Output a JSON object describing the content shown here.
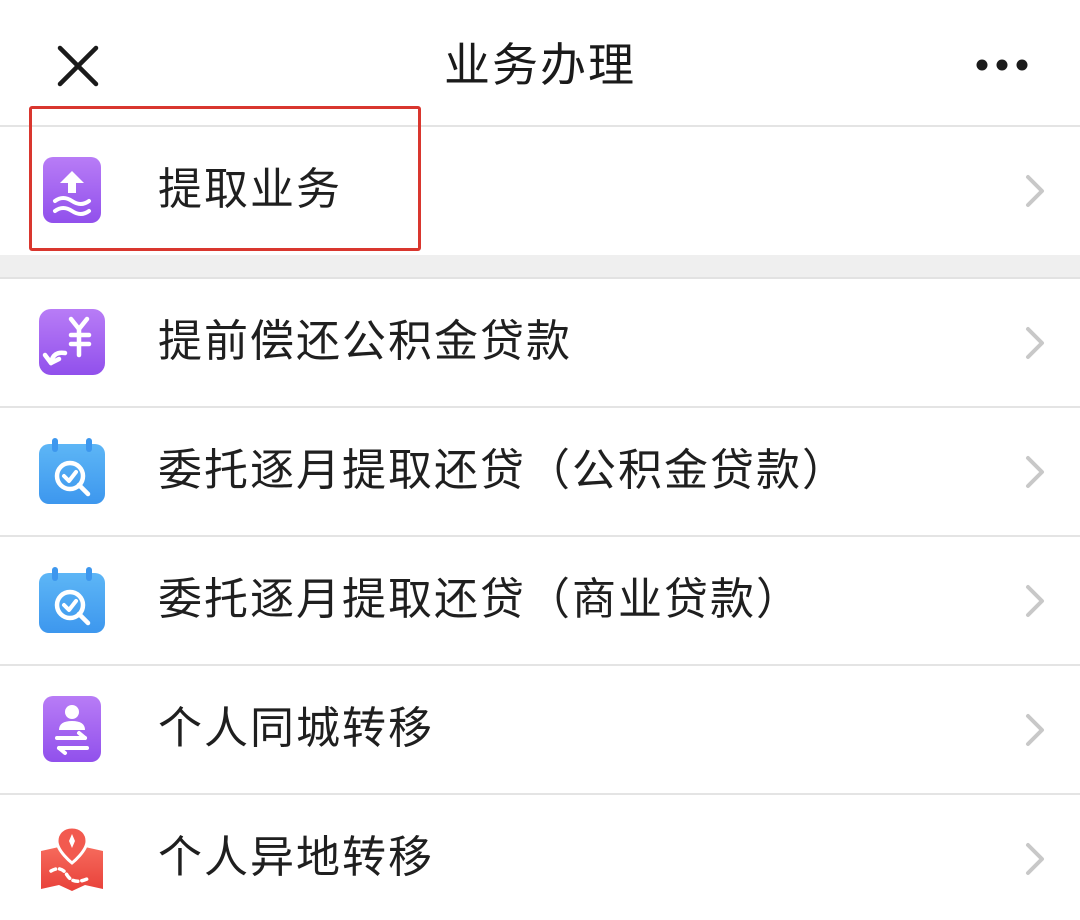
{
  "header": {
    "title": "业务办理",
    "close_icon": "close-icon",
    "more_icon": "more-dots-icon"
  },
  "featured": {
    "label": "提取业务",
    "icon": "withdraw-icon",
    "highlighted": true,
    "highlight_color": "#d9362e"
  },
  "list": {
    "items": [
      {
        "label": "提前偿还公积金贷款",
        "icon": "prepay-loan-icon"
      },
      {
        "label": "委托逐月提取还贷（公积金贷款）",
        "icon": "calendar-check-icon"
      },
      {
        "label": "委托逐月提取还贷（商业贷款）",
        "icon": "calendar-check-icon"
      },
      {
        "label": "个人同城转移",
        "icon": "person-transfer-icon"
      },
      {
        "label": "个人异地转移",
        "icon": "map-location-icon"
      }
    ]
  },
  "colors": {
    "purple_icon": "#9b5cf0",
    "blue_icon": "#49a6f2",
    "red_icon": "#ef5046",
    "chevron": "#c8c8c8"
  }
}
